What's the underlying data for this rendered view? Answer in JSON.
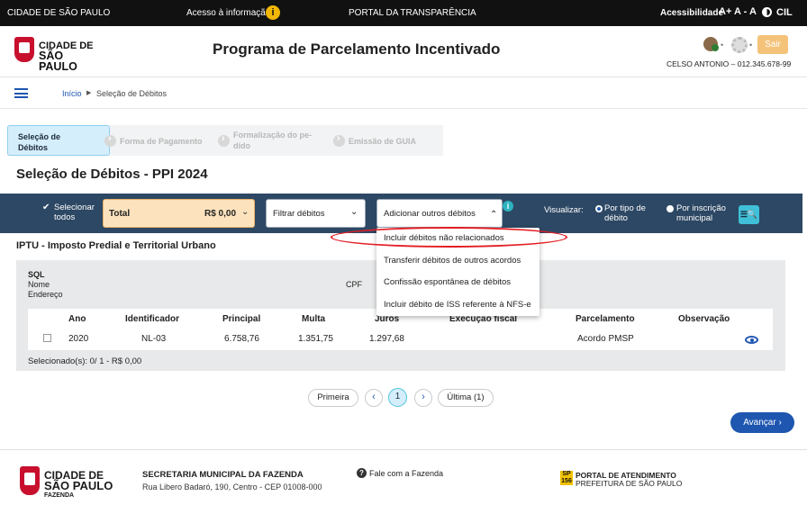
{
  "govbar": {
    "city": "CIDADE DE SÃO PAULO",
    "access_info": "Acesso à informação",
    "info_glyph": "i",
    "portal": "PORTAL DA TRANSPARÊNCIA",
    "accessibility": "Acessibilidade",
    "font_increase": "A+",
    "font_decrease": "A -",
    "font_reset": "A",
    "cil": "CIL"
  },
  "header": {
    "logo_line1": "CIDADE DE",
    "logo_line2": "SÃO PAULO",
    "title": "Programa de Parcelamento Incentivado",
    "dot1": "•",
    "dot2": "•",
    "logout": "Sair",
    "user": "CELSO ANTONIO – 012.345.678-99"
  },
  "breadcrumb": {
    "home": "Início",
    "separator": "▶",
    "current": "Seleção de Débitos"
  },
  "stepper": {
    "steps": [
      {
        "label": "Seleção de Débitos",
        "active": true
      },
      {
        "label": "Forma de Pagamento",
        "active": false
      },
      {
        "label": "Formalização do pe-dido",
        "active": false
      },
      {
        "label": "Emissão de GUIA",
        "active": false
      }
    ]
  },
  "page": {
    "title": "Seleção de Débitos - PPI 2024"
  },
  "toolbar": {
    "select_all_check": "✔",
    "select_all": "Selecionar todos",
    "total_label": "Total",
    "total_value": "R$ 0,00",
    "total_chevron": "⌄",
    "filter": "Filtrar débitos",
    "filter_chevron": "⌄",
    "add_other": "Adicionar outros débitos",
    "add_chevron": "⌃",
    "info": "i",
    "view_label": "Visualizar:",
    "view_by_type": "Por tipo de débito",
    "view_by_registration": "Por inscrição municipal",
    "search_icon": "☰🔍"
  },
  "dropdown": {
    "items": [
      "Incluir débitos não relacionados",
      "Transferir débitos de outros acordos",
      "Confissão espontânea de débitos",
      "Incluir débito de ISS referente à NFS-e"
    ],
    "highlight_color": "#e31e24"
  },
  "section": {
    "title": "IPTU - Imposto Predial e Territorial Urbano",
    "sql_label": "SQL",
    "name_label": "Nome",
    "address_label": "Endereço",
    "cpf_label": "CPF",
    "columns": [
      "Ano",
      "Identificador",
      "Principal",
      "Multa",
      "Juros",
      "Execução fiscal",
      "Parcelamento",
      "Observação"
    ],
    "rows": [
      {
        "ano": "2020",
        "identificador": "NL-03",
        "principal": "6.758,76",
        "multa": "1.351,75",
        "juros": "1.297,68",
        "execucao": "",
        "parcelamento": "Acordo PMSP",
        "observacao": "eye-icon"
      }
    ],
    "selected_info": "Selecionado(s): 0/ 1 - R$ 0,00"
  },
  "pagination": {
    "first": "Primeira",
    "prev": "‹",
    "current": "1",
    "next": "›",
    "last": "Última (1)"
  },
  "actions": {
    "next": "Avançar ›"
  },
  "footer": {
    "logo_line1": "CIDADE DE",
    "logo_line2": "SÃO PAULO",
    "logo_line3": "FAZENDA",
    "secretaria": "SECRETARIA MUNICIPAL DA FAZENDA",
    "address": "Rua Libero Badaró, 190, Centro - CEP 01008-000",
    "contact_icon": "?",
    "contact": "Fale com a Fazenda",
    "badge": "SP 156",
    "portal_line1": "PORTAL DE ATENDIMENTO",
    "portal_line2": "PREFEITURA DE SÃO PAULO"
  },
  "colors": {
    "toolbar_bg": "#2d4864",
    "primary": "#1e56b0",
    "total_bg": "#fde3bd",
    "step_active_bg": "#d5eefb",
    "logout_bg": "#f5c27a"
  }
}
